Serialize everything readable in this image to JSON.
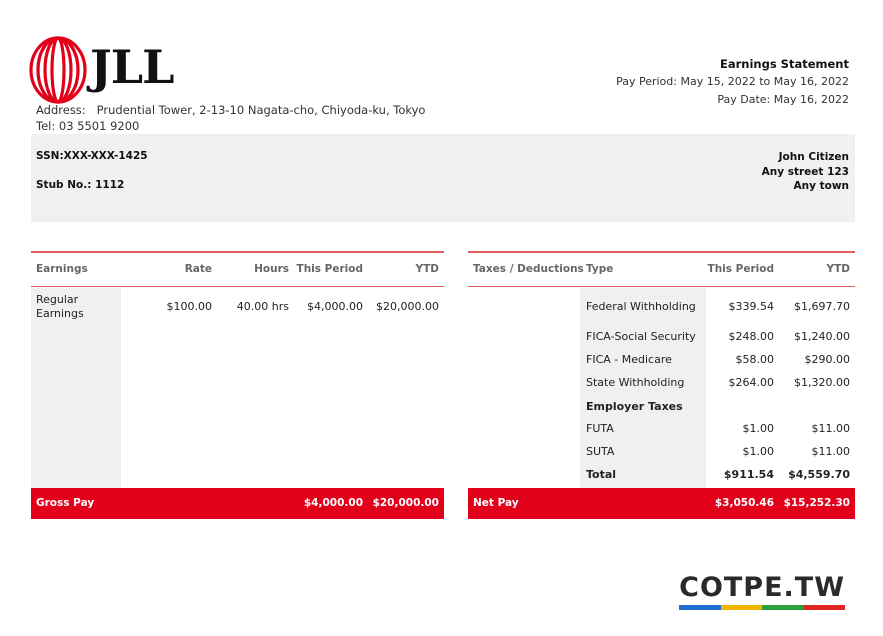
{
  "company": {
    "logo_text": "JLL",
    "address_label": "Address:",
    "address": "Prudential Tower, 2-13-10 Nagata-cho, Chiyoda-ku, Tokyo",
    "tel_label": "Tel:",
    "tel": "03 5501 9200"
  },
  "statement": {
    "title": "Earnings Statement",
    "pay_period_label": "Pay Period:",
    "pay_period_from": "May 15, 2022",
    "pay_period_to_word": "to",
    "pay_period_to": "May 16, 2022",
    "pay_date_label": "Pay Date:",
    "pay_date": "May 16, 2022"
  },
  "employee": {
    "ssn_label": "SSN:",
    "ssn": "XXX-XXX-1425",
    "stub_label": "Stub No.:",
    "stub": "1112",
    "name": "John Citizen",
    "street": "Any street 123",
    "town": "Any town"
  },
  "earnings": {
    "headers": [
      "Earnings",
      "Rate",
      "Hours",
      "This Period",
      "YTD"
    ],
    "rows": [
      {
        "name_line1": "Regular",
        "name_line2": "Earnings",
        "rate": "$100.00",
        "hours": "40.00 hrs",
        "this_period": "$4,000.00",
        "ytd": "$20,000.00"
      }
    ],
    "gross_label": "Gross Pay",
    "gross_this_period": "$4,000.00",
    "gross_ytd": "$20,000.00"
  },
  "deductions": {
    "headers": [
      "Taxes / Deductions",
      "Type",
      "This Period",
      "YTD"
    ],
    "rows": [
      {
        "type": "Federal Withholding",
        "this_period": "$339.54",
        "ytd": "$1,697.70"
      },
      {
        "type": "FICA-Social Security",
        "this_period": "$248.00",
        "ytd": "$1,240.00"
      },
      {
        "type": "FICA - Medicare",
        "this_period": "$58.00",
        "ytd": "$290.00"
      },
      {
        "type": "State Withholding",
        "this_period": "$264.00",
        "ytd": "$1,320.00"
      },
      {
        "type": "Employer Taxes",
        "this_period": "",
        "ytd": ""
      },
      {
        "type": "FUTA",
        "this_period": "$1.00",
        "ytd": "$11.00"
      },
      {
        "type": "SUTA",
        "this_period": "$1.00",
        "ytd": "$11.00"
      },
      {
        "type": "Total",
        "this_period": "$911.54",
        "ytd": "$4,559.70"
      }
    ],
    "net_label": "Net Pay",
    "net_this_period": "$3,050.46",
    "net_ytd": "$15,252.30"
  },
  "watermark": {
    "text": "COTPE.TW",
    "colors": [
      "#1f6fd1",
      "#f2b600",
      "#2aa13b",
      "#e02525"
    ]
  },
  "colors": {
    "accent": "#e2001a",
    "divider": "#e06060",
    "panel_grey": "#f0f0f0"
  }
}
